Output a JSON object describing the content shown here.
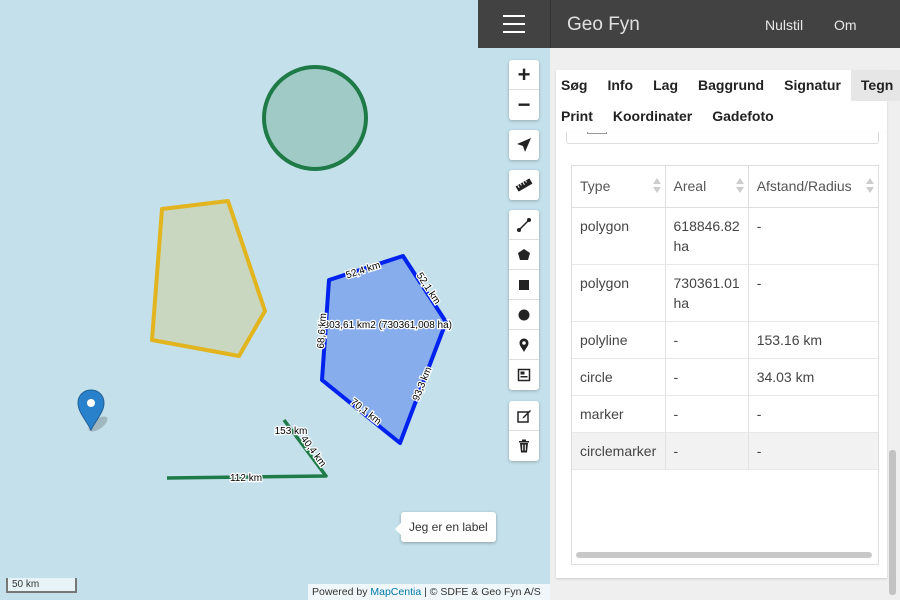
{
  "app": {
    "title": "Geo Fyn",
    "header_links": {
      "reset": "Nulstil",
      "about": "Om"
    }
  },
  "tabs": {
    "row1": [
      "Søg",
      "Info",
      "Lag",
      "Baggrund",
      "Signatur",
      "Tegn"
    ],
    "row2": [
      "Print",
      "Koordinater",
      "Gadefoto"
    ],
    "active": "Tegn"
  },
  "map": {
    "zoom_in": "+",
    "zoom_out": "−",
    "tool_icons": [
      "locate-arrow-icon",
      "ruler-icon",
      "draw-polyline-icon",
      "draw-polygon-icon",
      "draw-rectangle-icon",
      "draw-circle-icon",
      "draw-marker-icon",
      "draw-label-icon",
      "edit-icon",
      "delete-icon"
    ],
    "measurements": {
      "polygon_edge_top": "52,4 km",
      "polygon_edge_right_top": "52,1 km",
      "polygon_area": "7303,61 km2 (730361,008 ha)",
      "polygon_edge_left": "68,6 km",
      "polygon_edge_right_bottom": "93,3 km",
      "polygon_edge_bottom": "70,1 km",
      "polyline_total": "153 km",
      "polyline_segment_short": "40,4 km",
      "polyline_segment_long": "112 km"
    },
    "label_text": "Jeg er en label",
    "scale": "50 km",
    "attribution_prefix": "Powered by ",
    "attribution_link": "MapCentia",
    "attribution_suffix": " | © SDFE & Geo Fyn A/S",
    "colors": {
      "map_bg": "#c4e0ea",
      "circle": "#1e7a46",
      "polygon_yellow": "#e2b41e",
      "polygon_blue": "#0022ee",
      "polyline": "#1e7a46",
      "marker": "#2a81cb"
    }
  },
  "table": {
    "headers": [
      "Type",
      "Areal",
      "Afstand/Radius"
    ],
    "rows": [
      [
        "polygon",
        "618846.82 ha",
        "-"
      ],
      [
        "polygon",
        "730361.01 ha",
        "-"
      ],
      [
        "polyline",
        "-",
        "153.16 km"
      ],
      [
        "circle",
        "-",
        "34.03 km"
      ],
      [
        "marker",
        "-",
        "-"
      ],
      [
        "circlemarker",
        "-",
        "-"
      ]
    ]
  }
}
